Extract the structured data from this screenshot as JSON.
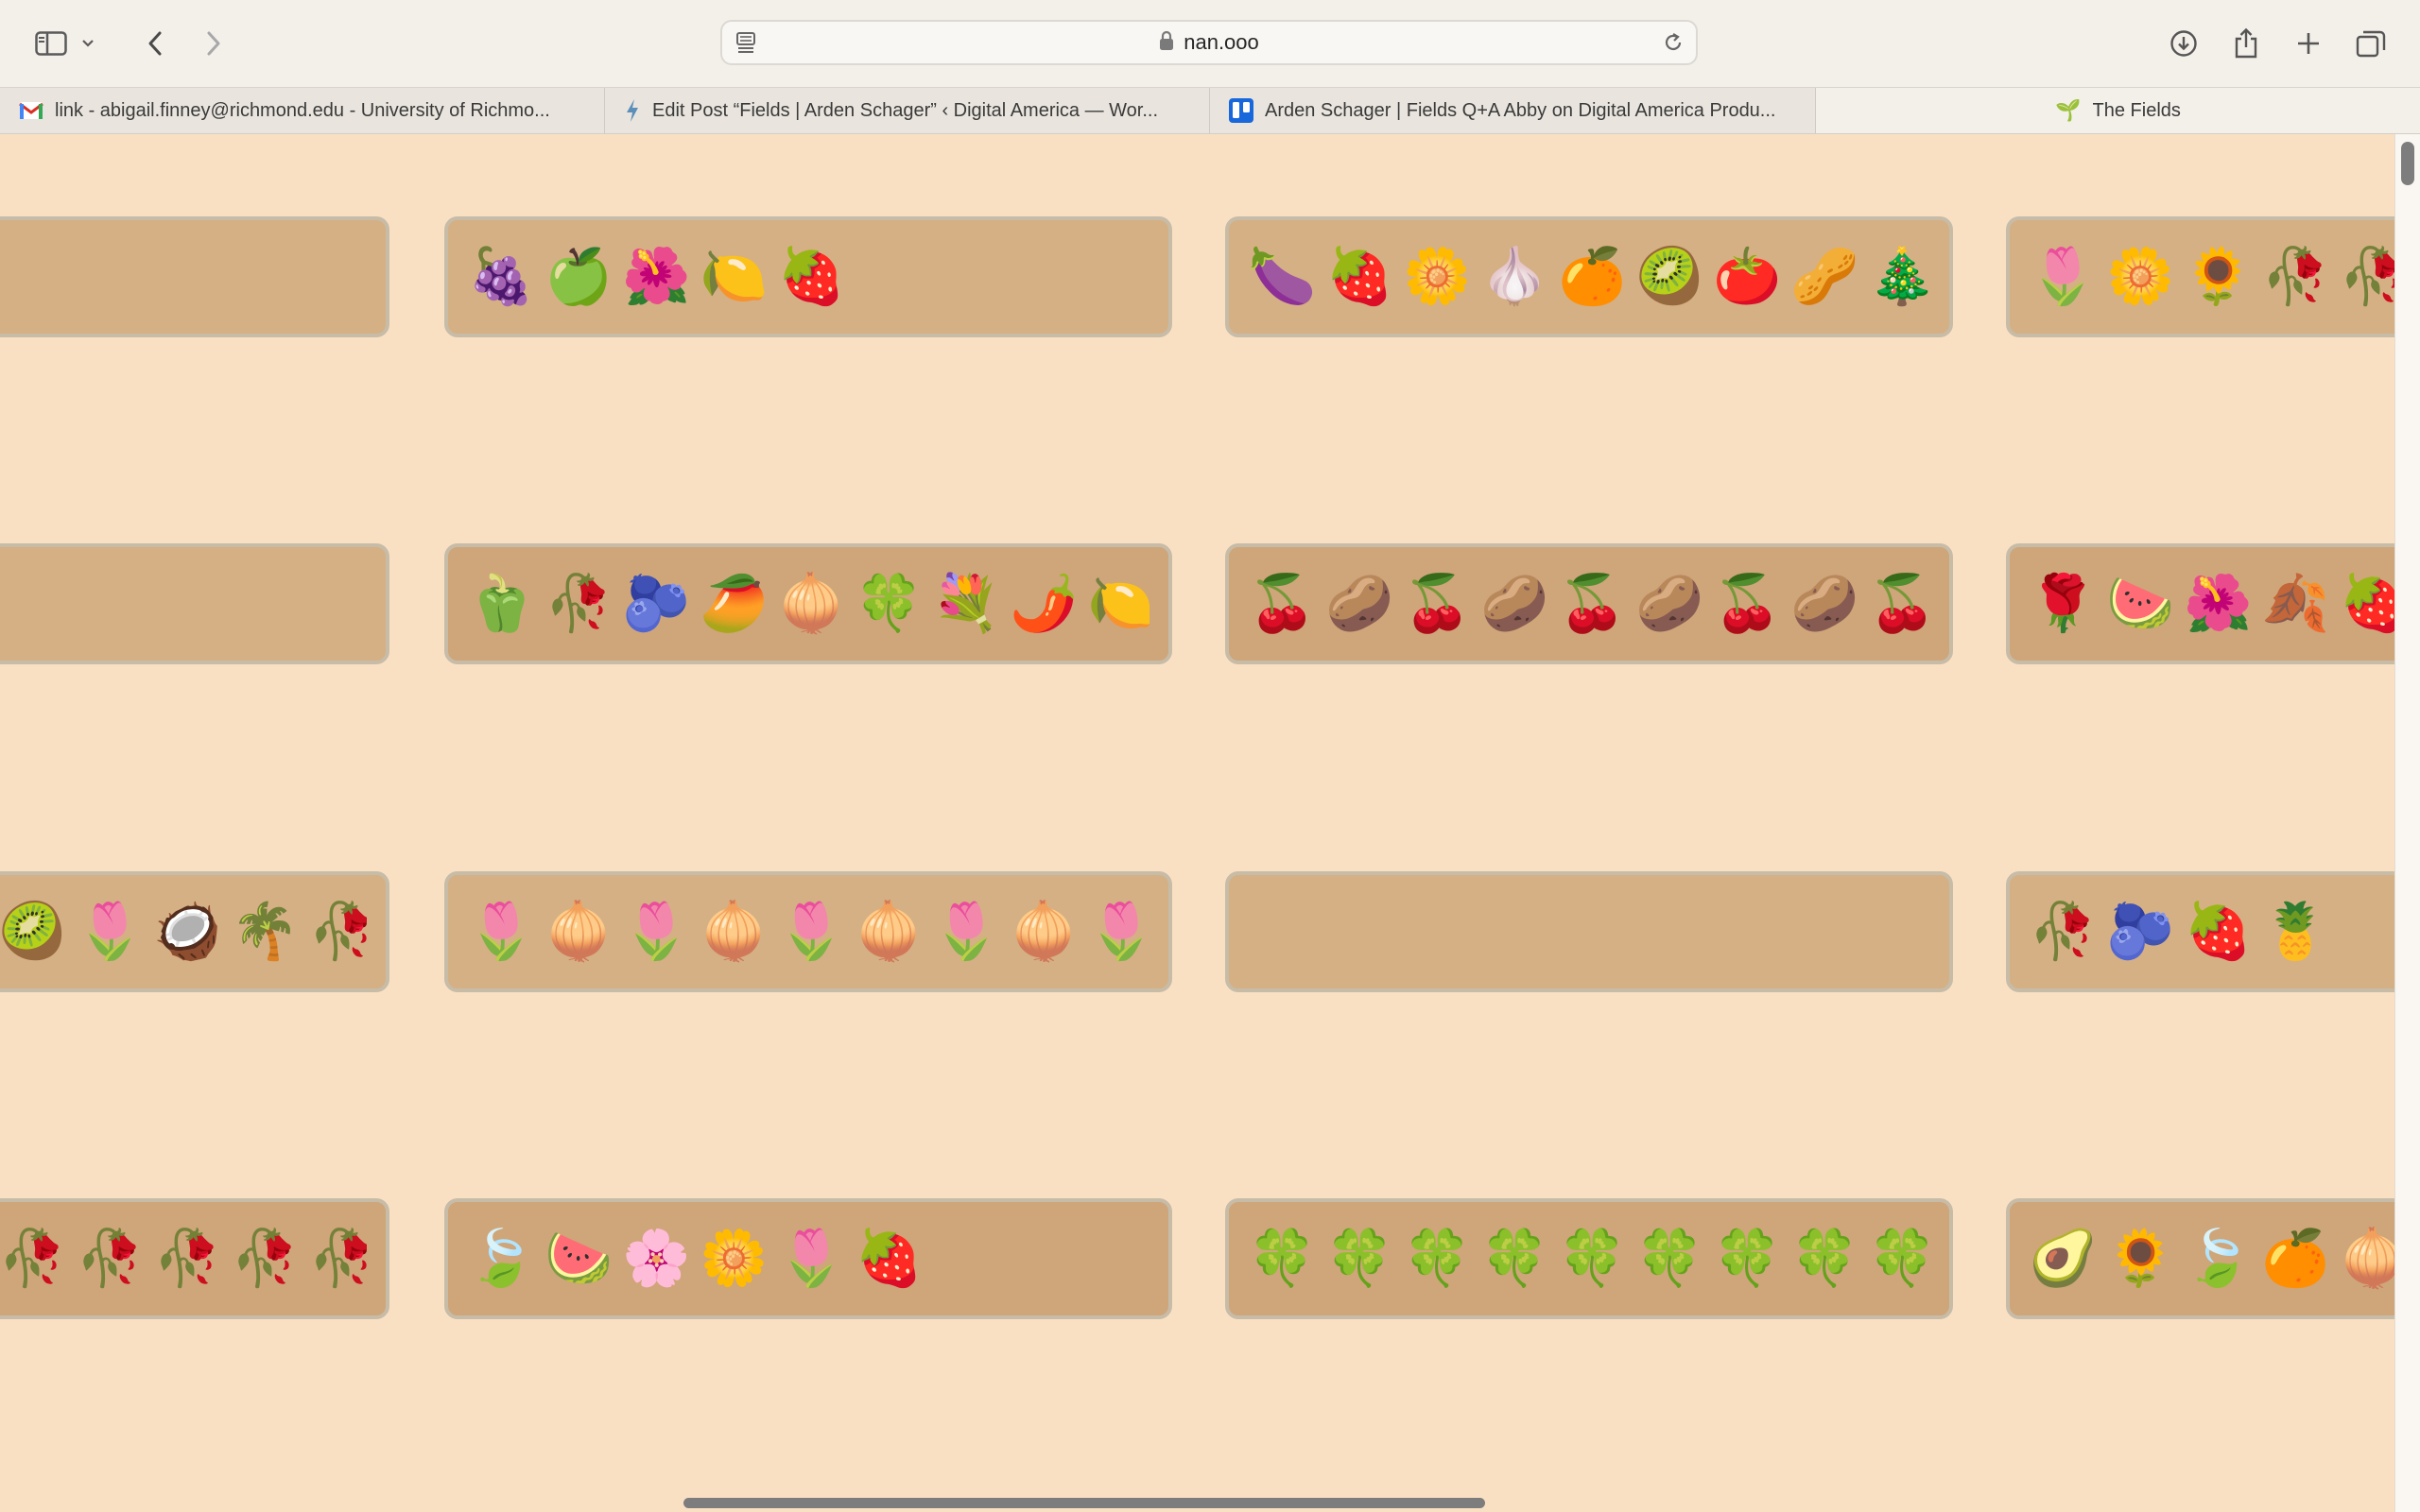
{
  "toolbar": {
    "url": "nan.ooo",
    "icons": [
      "sidebar-icon",
      "chevron-down-icon",
      "back-icon",
      "forward-icon",
      "reader-icon",
      "lock-icon",
      "reload-icon",
      "download-icon",
      "share-icon",
      "plus-icon",
      "tab-overview-icon"
    ]
  },
  "tabs": [
    {
      "title": "link - abigail.finney@richmond.edu - University of Richmo...",
      "icon": "gmail-icon",
      "active": false
    },
    {
      "title": "Edit Post “Fields | Arden Schager” ‹ Digital America — Wor...",
      "icon": "bolt-icon",
      "active": false
    },
    {
      "title": "Arden Schager | Fields Q+A Abby on Digital America Produ...",
      "icon": "trello-icon",
      "active": false
    },
    {
      "title": "The Fields",
      "icon": "seedling-icon",
      "active": true
    }
  ],
  "fields": [
    [
      "",
      "🍇🍏🌺🍋🍓",
      "🍆🍓🌼🧄🍊🥝🍅🥜🎄",
      "🌷🌼🌻🥀🥀"
    ],
    [
      "",
      "🫑🥀🫐🥭🧅🍀💐🌶️🍋",
      "🍒🥔🍒🥔🍒🥔🍒🥔🍒",
      "🌹🍉🌺🍂🍓"
    ],
    [
      "🥝🌷🥥🌴🥀",
      "🌷🧅🌷🧅🌷🧅🌷🧅🌷",
      "",
      "🥀🫐🍓🍍"
    ],
    [
      "🥀🥀🥀🥀🥀",
      "🍃🍉🌸🌼🌷🍓",
      "🍀🍀🍀🍀🍀🍀🍀🍀🍀",
      "🥑🌻🍃🍊🧅"
    ]
  ]
}
